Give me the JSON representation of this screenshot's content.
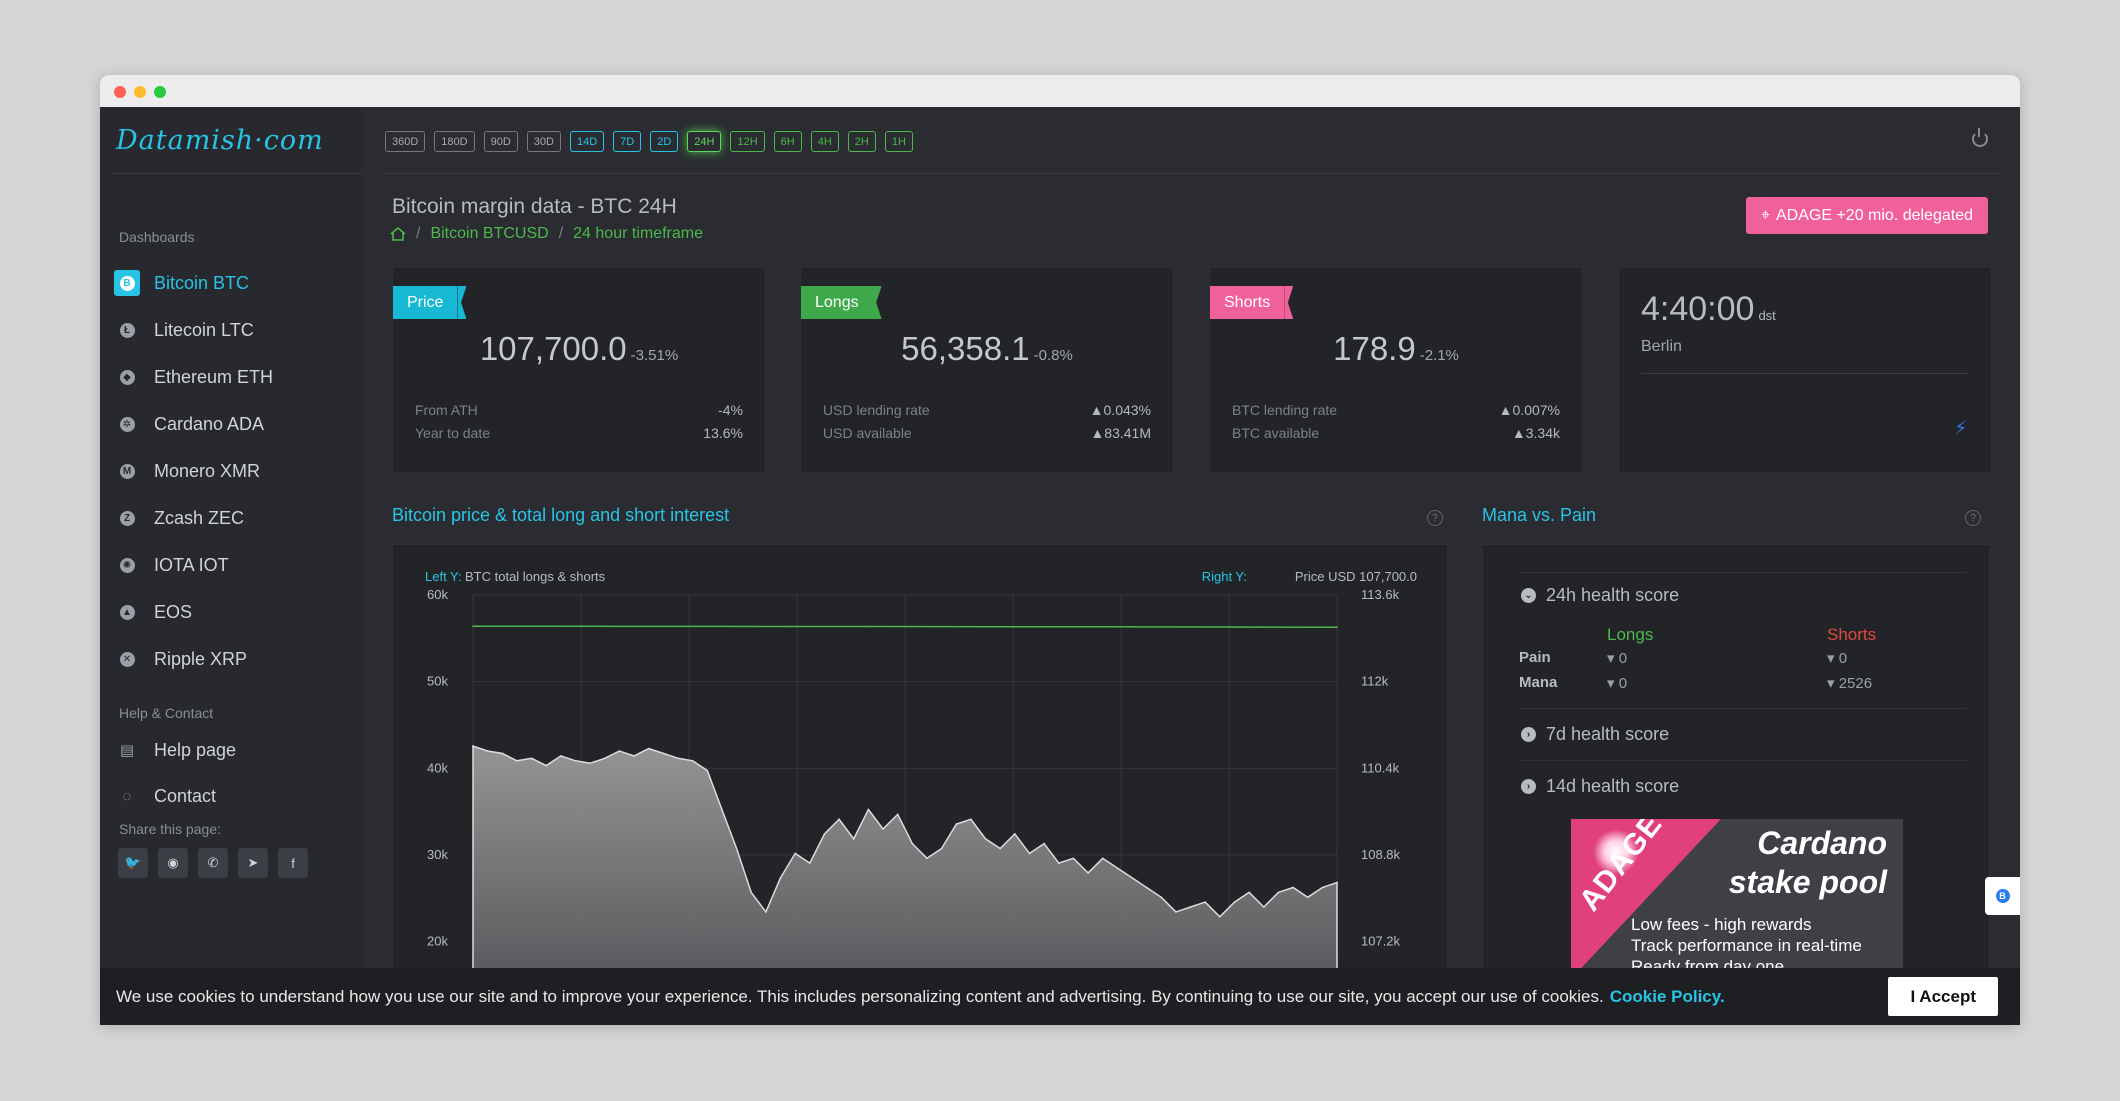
{
  "app": {
    "logo": "Datamish·com"
  },
  "timeframes": {
    "items": [
      {
        "label": "360D",
        "style": "gray"
      },
      {
        "label": "180D",
        "style": "gray"
      },
      {
        "label": "90D",
        "style": "gray"
      },
      {
        "label": "30D",
        "style": "gray"
      },
      {
        "label": "14D",
        "style": "blue"
      },
      {
        "label": "7D",
        "style": "blue"
      },
      {
        "label": "2D",
        "style": "blue"
      },
      {
        "label": "24H",
        "style": "active"
      },
      {
        "label": "12H",
        "style": "green"
      },
      {
        "label": "6H",
        "style": "green"
      },
      {
        "label": "4H",
        "style": "green"
      },
      {
        "label": "2H",
        "style": "green"
      },
      {
        "label": "1H",
        "style": "green"
      }
    ]
  },
  "sidebar": {
    "dashboards_heading": "Dashboards",
    "items": [
      {
        "label": "Bitcoin BTC",
        "icon": "bitcoin-icon",
        "glyph": "B",
        "active": true
      },
      {
        "label": "Litecoin LTC",
        "icon": "litecoin-icon",
        "glyph": "Ł"
      },
      {
        "label": "Ethereum ETH",
        "icon": "ethereum-icon",
        "glyph": "◆"
      },
      {
        "label": "Cardano ADA",
        "icon": "cardano-icon",
        "glyph": "✲"
      },
      {
        "label": "Monero XMR",
        "icon": "monero-icon",
        "glyph": "M"
      },
      {
        "label": "Zcash ZEC",
        "icon": "zcash-icon",
        "glyph": "Z"
      },
      {
        "label": "IOTA IOT",
        "icon": "iota-icon",
        "glyph": "✺"
      },
      {
        "label": "EOS",
        "icon": "eos-icon",
        "glyph": "▲"
      },
      {
        "label": "Ripple XRP",
        "icon": "ripple-icon",
        "glyph": "✕"
      }
    ],
    "help_heading": "Help & Contact",
    "help_items": [
      {
        "label": "Help page",
        "icon": "book-icon",
        "glyph": "▤"
      },
      {
        "label": "Contact",
        "icon": "chat-bubble-icon",
        "glyph": "◌"
      }
    ],
    "share_heading": "Share this page:",
    "share_buttons": [
      {
        "icon": "twitter-icon",
        "glyph": "🐦"
      },
      {
        "icon": "reddit-icon",
        "glyph": "◉"
      },
      {
        "icon": "whatsapp-icon",
        "glyph": "✆"
      },
      {
        "icon": "telegram-icon",
        "glyph": "➤"
      },
      {
        "icon": "facebook-icon",
        "glyph": "f"
      }
    ]
  },
  "header": {
    "title": "Bitcoin margin data - BTC 24H",
    "breadcrumb": [
      "Bitcoin BTCUSD",
      "24 hour timeframe"
    ],
    "delegate_button": "ADAGE +20 mio. delegated"
  },
  "cards": {
    "price": {
      "tag": "Price",
      "value": "107,700.0",
      "change": "-3.51%",
      "rows": [
        {
          "label": "From ATH",
          "value": "-4%"
        },
        {
          "label": "Year to date",
          "value": "13.6%"
        }
      ]
    },
    "longs": {
      "tag": "Longs",
      "value": "56,358.1",
      "change": "-0.8%",
      "rows": [
        {
          "label": "USD lending rate",
          "value": "▲0.043%"
        },
        {
          "label": "USD available",
          "value": "▲83.41M"
        }
      ]
    },
    "shorts": {
      "tag": "Shorts",
      "value": "178.9",
      "change": "-2.1%",
      "rows": [
        {
          "label": "BTC lending rate",
          "value": "▲0.007%"
        },
        {
          "label": "BTC available",
          "value": "▲3.34k"
        }
      ]
    },
    "clock": {
      "time": "4:40:00",
      "suffix": "dst",
      "city": "Berlin"
    }
  },
  "chart_section": {
    "title": "Bitcoin price & total long and short interest",
    "left_label_prefix": "Left Y:",
    "left_label": "BTC total longs & shorts",
    "right_label_prefix": "Right Y:",
    "right_label": "Price USD 107,700.0"
  },
  "chart_data": {
    "type": "area",
    "yleft_ticks": [
      "60k",
      "50k",
      "40k",
      "30k",
      "20k"
    ],
    "yright_ticks": [
      "113.6k",
      "112k",
      "110.4k",
      "108.8k",
      "107.2k"
    ],
    "yleft_range": [
      15000,
      60000
    ],
    "yright_range": [
      105600,
      113600
    ],
    "series": [
      {
        "name": "longs",
        "color": "#4cb84c",
        "axis": "left",
        "values": [
          56400,
          56400,
          56380,
          56380,
          56360,
          56360,
          56350,
          56340,
          56330,
          56320,
          56300,
          56290
        ]
      },
      {
        "name": "price",
        "color": "#9a9a9a",
        "axis": "right",
        "values": [
          110500,
          110400,
          110350,
          110200,
          110250,
          110100,
          110300,
          110200,
          110150,
          110250,
          110400,
          110300,
          110450,
          110350,
          110250,
          110200,
          110000,
          109200,
          108400,
          107500,
          107100,
          107800,
          108300,
          108100,
          108700,
          109000,
          108600,
          109200,
          108800,
          109100,
          108500,
          108200,
          108400,
          108900,
          109000,
          108600,
          108400,
          108700,
          108300,
          108500,
          108100,
          108200,
          107900,
          108200,
          108000,
          107800,
          107600,
          107400,
          107100,
          107200,
          107300,
          107000,
          107300,
          107500,
          107200,
          107500,
          107600,
          107400,
          107600,
          107700
        ]
      }
    ]
  },
  "mana": {
    "title": "Mana vs. Pain",
    "section_24h": "24h health score",
    "longs_header": "Longs",
    "shorts_header": "Shorts",
    "pain_label": "Pain",
    "mana_label": "Mana",
    "pain_longs": "0",
    "pain_shorts": "0",
    "mana_longs": "0",
    "mana_shorts": "2526",
    "section_7d": "7d health score",
    "section_14d": "14d health score",
    "ad": {
      "brand": "ADAGE",
      "title_1": "Cardano",
      "title_2": "stake pool",
      "line_1": "Low fees - high rewards",
      "line_2": "Track performance in real-time",
      "line_3": "Ready from day one"
    }
  },
  "cookie": {
    "text": "We use cookies to understand how you use our site and to improve your experience. This includes personalizing content and advertising. By continuing to use our site, you accept our use of cookies.",
    "link": "Cookie Policy.",
    "accept": "I Accept"
  },
  "colors": {
    "accent": "#27c4e5",
    "green": "#4cb84c",
    "pink": "#f0609a"
  }
}
